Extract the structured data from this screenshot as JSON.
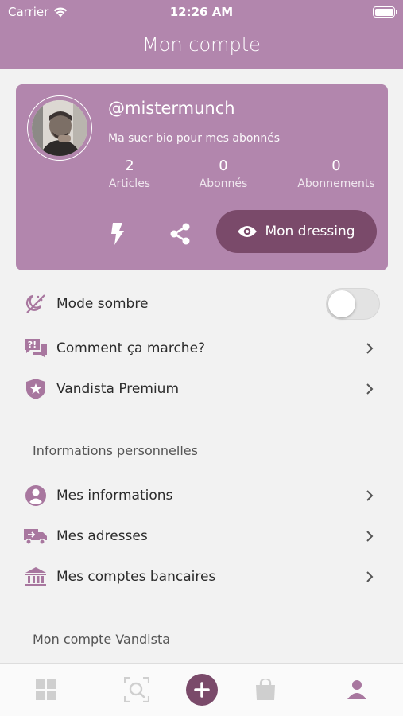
{
  "status_bar": {
    "carrier": "Carrier",
    "time": "12:26 AM"
  },
  "header": {
    "title": "Mon compte"
  },
  "profile": {
    "username": "@mistermunch",
    "bio": "Ma suer bio pour mes abonnés",
    "stats": [
      {
        "value": "2",
        "label": "Articles"
      },
      {
        "value": "0",
        "label": "Abonnés"
      },
      {
        "value": "0",
        "label": "Abonnements"
      }
    ],
    "dressing_button": "Mon dressing"
  },
  "settings": {
    "dark_mode": {
      "label": "Mode sombre",
      "enabled": false
    },
    "how_it_works": "Comment ça marche?",
    "premium": "Vandista Premium"
  },
  "personal_info": {
    "section_title": "Informations personnelles",
    "items": [
      "Mes informations",
      "Mes adresses",
      "Mes comptes bancaires"
    ]
  },
  "account_section": {
    "section_title": "Mon compte Vandista"
  },
  "colors": {
    "accent": "#b286ad",
    "accent_dark": "#7a4a6a",
    "icon": "#a8779f",
    "inactive": "#cfcfcf"
  },
  "tabbar": {
    "icons": [
      "grid-icon",
      "search-icon",
      "add-icon",
      "bag-icon",
      "profile-icon"
    ],
    "active": "profile-icon"
  }
}
